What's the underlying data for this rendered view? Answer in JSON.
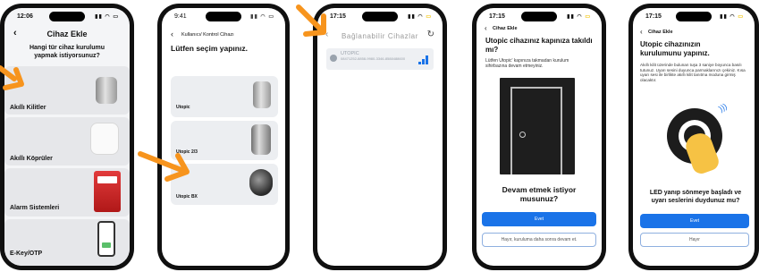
{
  "colors": {
    "orange": "#f7941d",
    "blue": "#1a73e8"
  },
  "phone1": {
    "time": "12:06",
    "title": "Cihaz Ekle",
    "question": "Hangi tür cihaz kurulumu yapmak istiyorsunuz?",
    "categories": [
      {
        "label": "Akıllı Kilitler"
      },
      {
        "label": "Akıllı Köprüler"
      },
      {
        "label": "Alarm Sistemleri"
      },
      {
        "label": "E-Key/OTP"
      }
    ]
  },
  "phone2": {
    "time": "9:41",
    "breadcrumb": "Kullanıcı/ Kontrol Cihazı",
    "heading": "Lütfen seçim yapınız.",
    "products": [
      {
        "label": "Utopic"
      },
      {
        "label": "Utopic 2/3"
      },
      {
        "label": "Utopic BX"
      }
    ]
  },
  "phone3": {
    "time": "17:15",
    "title": "Bağlanabilir Cihazlar",
    "device_name": "UTOPIC",
    "device_id": "08471252-8858-9980-3346-8588488600"
  },
  "phone4": {
    "time": "17:15",
    "title": "Cihaz Ekle",
    "heading": "Utopic cihazınız kapınıza takıldı mı?",
    "body": "Lütfen Utopic' kapınıza takmadan kurulum sihirbazına devam etmeyiniz.",
    "question": "Devam etmek istiyor musunuz?",
    "yes": "Evet",
    "no": "Hayır, kuruluma daha sonra devam et."
  },
  "phone5": {
    "time": "17:15",
    "title": "Cihaz Ekle",
    "heading": "Utopic cihazınızın kurulumunu yapınız.",
    "body": "Akıllı kilit üzerinde bulunan tuşa 3 saniye boyunca basılı tutunuz. Uyarı sesini duyunca parmaklarınızı çekiniz. Kısa uyarı sesi ile birlikte akıllı kilit tanıtma moduna girmiş olacaktır.",
    "question": "LED yanıp sönmeye başladı ve uyarı seslerini duydunuz mu?",
    "yes": "Evet",
    "no": "Hayır"
  }
}
